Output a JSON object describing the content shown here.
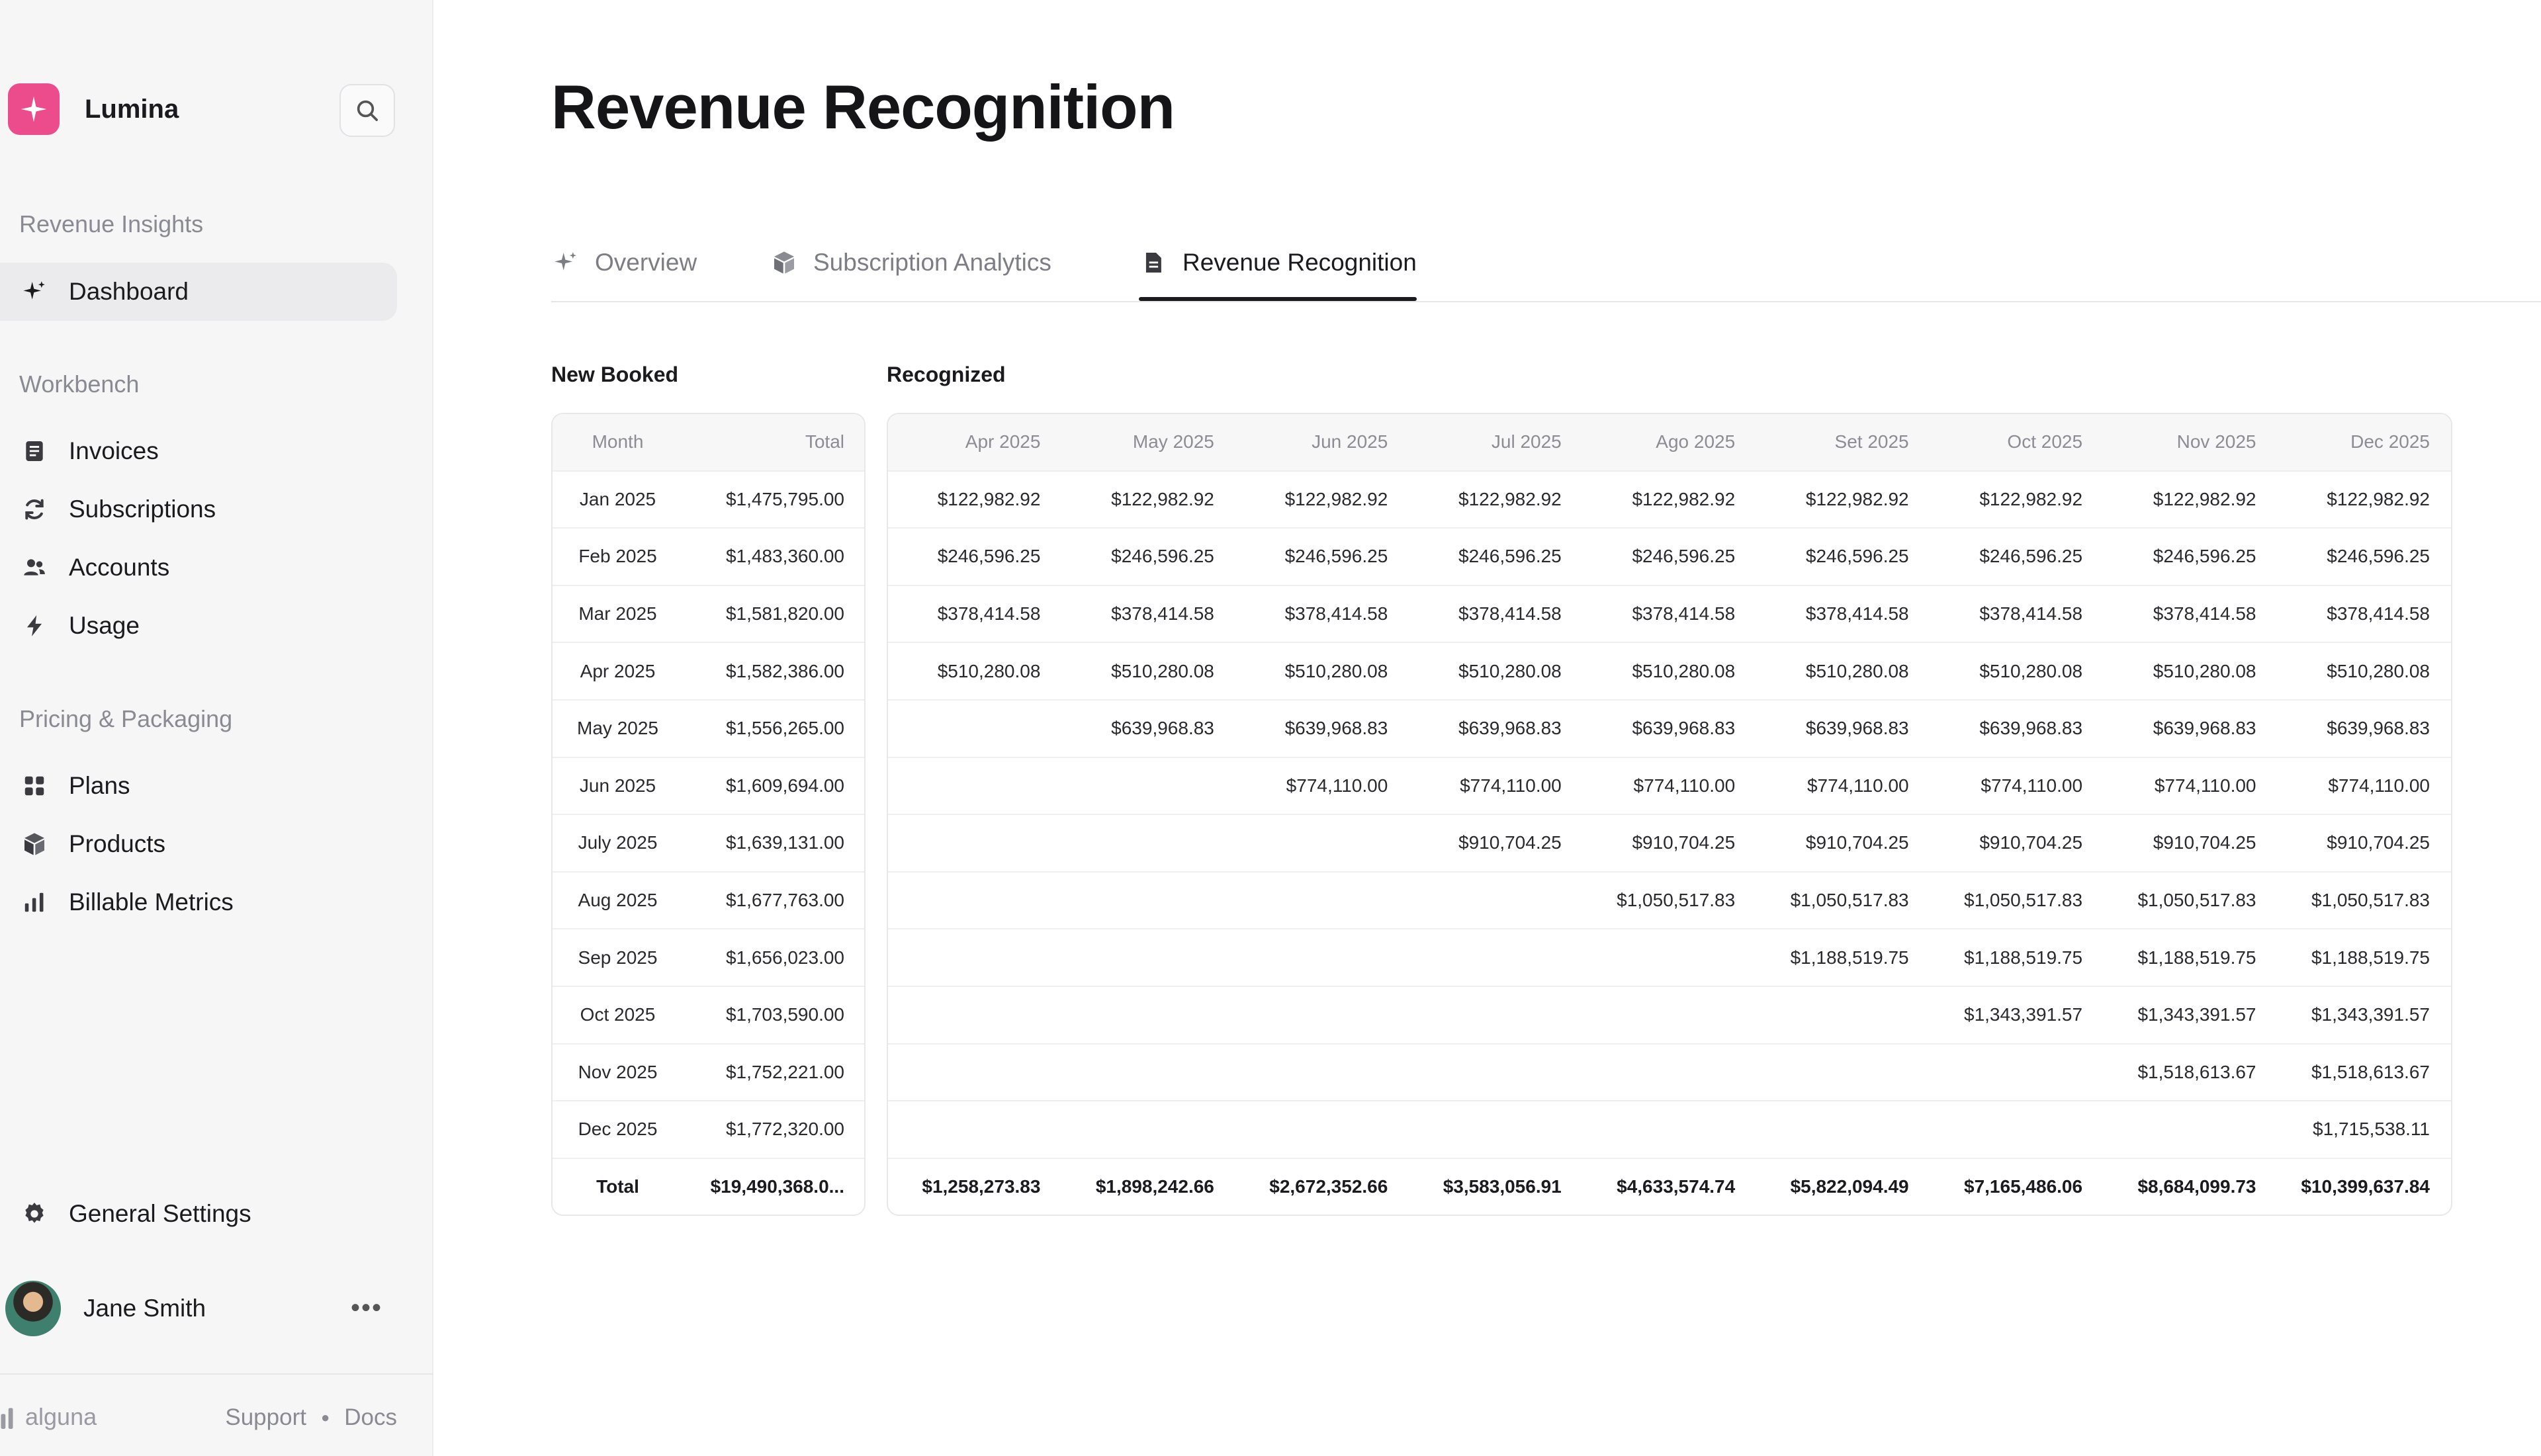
{
  "app": {
    "name": "Lumina"
  },
  "sidebar": {
    "sections": [
      {
        "label": "Revenue Insights",
        "items": [
          {
            "label": "Dashboard",
            "icon": "sparkle-icon",
            "active": true
          }
        ]
      },
      {
        "label": "Workbench",
        "items": [
          {
            "label": "Invoices",
            "icon": "invoice-icon"
          },
          {
            "label": "Subscriptions",
            "icon": "refresh-icon"
          },
          {
            "label": "Accounts",
            "icon": "users-icon"
          },
          {
            "label": "Usage",
            "icon": "bolt-icon"
          }
        ]
      },
      {
        "label": "Pricing & Packaging",
        "items": [
          {
            "label": "Plans",
            "icon": "grid-icon"
          },
          {
            "label": "Products",
            "icon": "box-icon"
          },
          {
            "label": "Billable Metrics",
            "icon": "bar-chart-icon"
          }
        ]
      }
    ],
    "settings_label": "General Settings",
    "user": {
      "name": "Jane Smith"
    },
    "footer": {
      "brand": "alguna",
      "support": "Support",
      "docs": "Docs"
    }
  },
  "page": {
    "title": "Revenue Recognition"
  },
  "tabs": [
    {
      "label": "Overview",
      "icon": "sparkle-icon",
      "active": false
    },
    {
      "label": "Subscription Analytics",
      "icon": "box-icon",
      "active": false
    },
    {
      "label": "Revenue Recognition",
      "icon": "document-icon",
      "active": true
    }
  ],
  "booked": {
    "heading": "New Booked",
    "columns": [
      "Month",
      "Total"
    ],
    "rows": [
      [
        "Jan 2025",
        "$1,475,795.00"
      ],
      [
        "Feb 2025",
        "$1,483,360.00"
      ],
      [
        "Mar 2025",
        "$1,581,820.00"
      ],
      [
        "Apr 2025",
        "$1,582,386.00"
      ],
      [
        "May 2025",
        "$1,556,265.00"
      ],
      [
        "Jun 2025",
        "$1,609,694.00"
      ],
      [
        "July 2025",
        "$1,639,131.00"
      ],
      [
        "Aug 2025",
        "$1,677,763.00"
      ],
      [
        "Sep 2025",
        "$1,656,023.00"
      ],
      [
        "Oct 2025",
        "$1,703,590.00"
      ],
      [
        "Nov 2025",
        "$1,752,221.00"
      ],
      [
        "Dec 2025",
        "$1,772,320.00"
      ]
    ],
    "total_label": "Total",
    "total_value": "$19,490,368.0..."
  },
  "recognized": {
    "heading": "Recognized",
    "columns": [
      "Apr 2025",
      "May 2025",
      "Jun 2025",
      "Jul 2025",
      "Ago 2025",
      "Set 2025",
      "Oct 2025",
      "Nov 2025",
      "Dec 2025"
    ],
    "rows": [
      [
        "$122,982.92",
        "$122,982.92",
        "$122,982.92",
        "$122,982.92",
        "$122,982.92",
        "$122,982.92",
        "$122,982.92",
        "$122,982.92",
        "$122,982.92"
      ],
      [
        "$246,596.25",
        "$246,596.25",
        "$246,596.25",
        "$246,596.25",
        "$246,596.25",
        "$246,596.25",
        "$246,596.25",
        "$246,596.25",
        "$246,596.25"
      ],
      [
        "$378,414.58",
        "$378,414.58",
        "$378,414.58",
        "$378,414.58",
        "$378,414.58",
        "$378,414.58",
        "$378,414.58",
        "$378,414.58",
        "$378,414.58"
      ],
      [
        "$510,280.08",
        "$510,280.08",
        "$510,280.08",
        "$510,280.08",
        "$510,280.08",
        "$510,280.08",
        "$510,280.08",
        "$510,280.08",
        "$510,280.08"
      ],
      [
        "",
        "$639,968.83",
        "$639,968.83",
        "$639,968.83",
        "$639,968.83",
        "$639,968.83",
        "$639,968.83",
        "$639,968.83",
        "$639,968.83"
      ],
      [
        "",
        "",
        "$774,110.00",
        "$774,110.00",
        "$774,110.00",
        "$774,110.00",
        "$774,110.00",
        "$774,110.00",
        "$774,110.00"
      ],
      [
        "",
        "",
        "",
        "$910,704.25",
        "$910,704.25",
        "$910,704.25",
        "$910,704.25",
        "$910,704.25",
        "$910,704.25"
      ],
      [
        "",
        "",
        "",
        "",
        "$1,050,517.83",
        "$1,050,517.83",
        "$1,050,517.83",
        "$1,050,517.83",
        "$1,050,517.83"
      ],
      [
        "",
        "",
        "",
        "",
        "",
        "$1,188,519.75",
        "$1,188,519.75",
        "$1,188,519.75",
        "$1,188,519.75"
      ],
      [
        "",
        "",
        "",
        "",
        "",
        "",
        "$1,343,391.57",
        "$1,343,391.57",
        "$1,343,391.57"
      ],
      [
        "",
        "",
        "",
        "",
        "",
        "",
        "",
        "$1,518,613.67",
        "$1,518,613.67"
      ],
      [
        "",
        "",
        "",
        "",
        "",
        "",
        "",
        "",
        "$1,715,538.11"
      ]
    ],
    "totals": [
      "$1,258,273.83",
      "$1,898,242.66",
      "$2,672,352.66",
      "$3,583,056.91",
      "$4,633,574.74",
      "$5,822,094.49",
      "$7,165,486.06",
      "$8,684,099.73",
      "$10,399,637.84"
    ]
  }
}
